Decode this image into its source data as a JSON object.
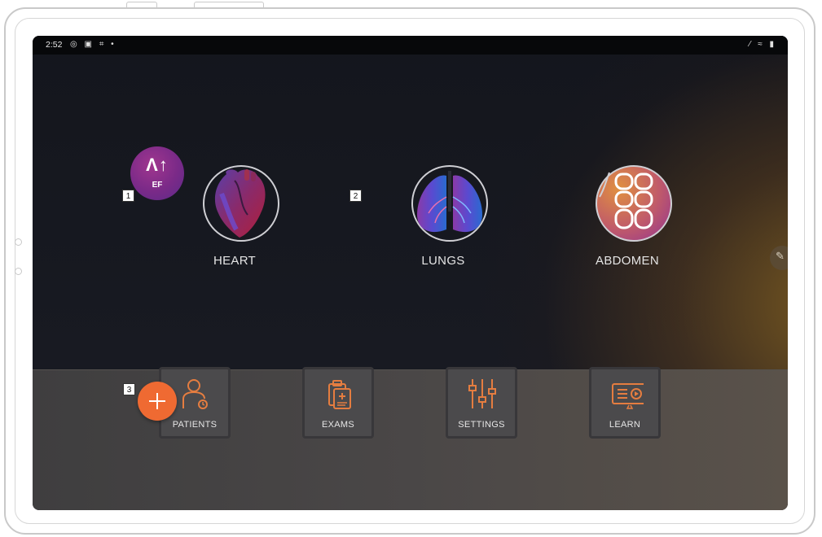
{
  "status_bar": {
    "time": "2:52",
    "left_icons": "◎ ▣ ⌗ •",
    "right_icons": "⁄ ≈ ▮"
  },
  "exam_types": [
    {
      "label": "HEART",
      "icon": "heart-icon",
      "callout": "1"
    },
    {
      "label": "LUNGS",
      "icon": "lungs-icon",
      "callout": "2"
    },
    {
      "label": "ABDOMEN",
      "icon": "abdomen-icon"
    }
  ],
  "ai_badge": {
    "glyph": "Λ↑",
    "text": "EF"
  },
  "fab": {
    "callout": "3",
    "icon": "plus-icon",
    "color": "#ef6a32"
  },
  "nav": [
    {
      "label": "PATIENTS",
      "icon": "patient-icon"
    },
    {
      "label": "EXAMS",
      "icon": "clipboard-icon"
    },
    {
      "label": "SETTINGS",
      "icon": "sliders-icon"
    },
    {
      "label": "LEARN",
      "icon": "video-icon"
    }
  ],
  "colors": {
    "accent": "#ef6a32",
    "ai_badge": "#7a2a88",
    "screen_bg": "#15171d"
  }
}
